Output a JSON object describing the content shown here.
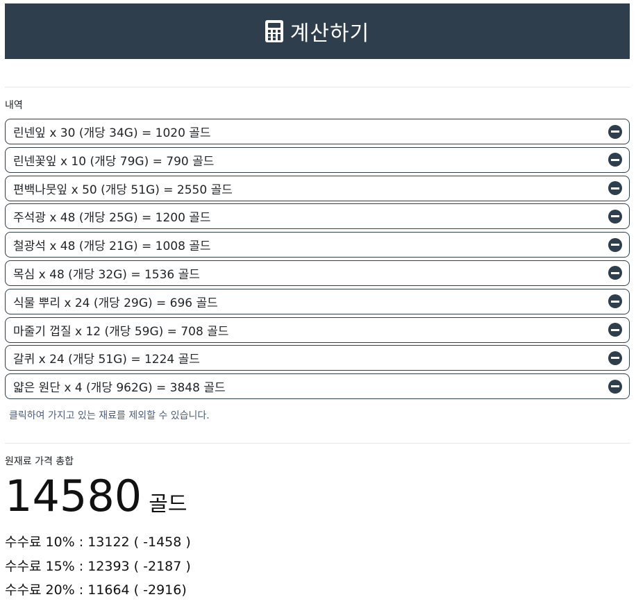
{
  "header": {
    "icon": "calculator-icon",
    "title": "계산하기",
    "bg_color": "#2f3e4c"
  },
  "history": {
    "label": "내역",
    "items": [
      "린넨잎 x 30 (개당 34G) = 1020 골드",
      "린넨꽃잎 x 10 (개당 79G) = 790 골드",
      "편백나뭇잎 x 50 (개당 51G) = 2550 골드",
      "주석광 x 48 (개당 25G) = 1200 골드",
      "철광석 x 48 (개당 21G) = 1008 골드",
      "목심 x 48 (개당 32G) = 1536 골드",
      "식물 뿌리 x 24 (개당 29G) = 696 골드",
      "마줄기 껍질 x 12 (개당 59G) = 708 골드",
      "갈퀴 x 24 (개당 51G) = 1224 골드",
      "얇은 원단 x 4 (개당 962G) = 3848 골드"
    ],
    "hint": "클릭하여 가지고 있는 재료를 제외할 수 있습니다."
  },
  "summary": {
    "label": "원재료 가격 총합",
    "total": "14580",
    "unit": "골드",
    "fees": [
      "수수료 10% : 13122 ( -1458 )",
      "수수료 15% : 12393 ( -2187 )",
      "수수료 20% : 11664 ( -2916)"
    ]
  }
}
